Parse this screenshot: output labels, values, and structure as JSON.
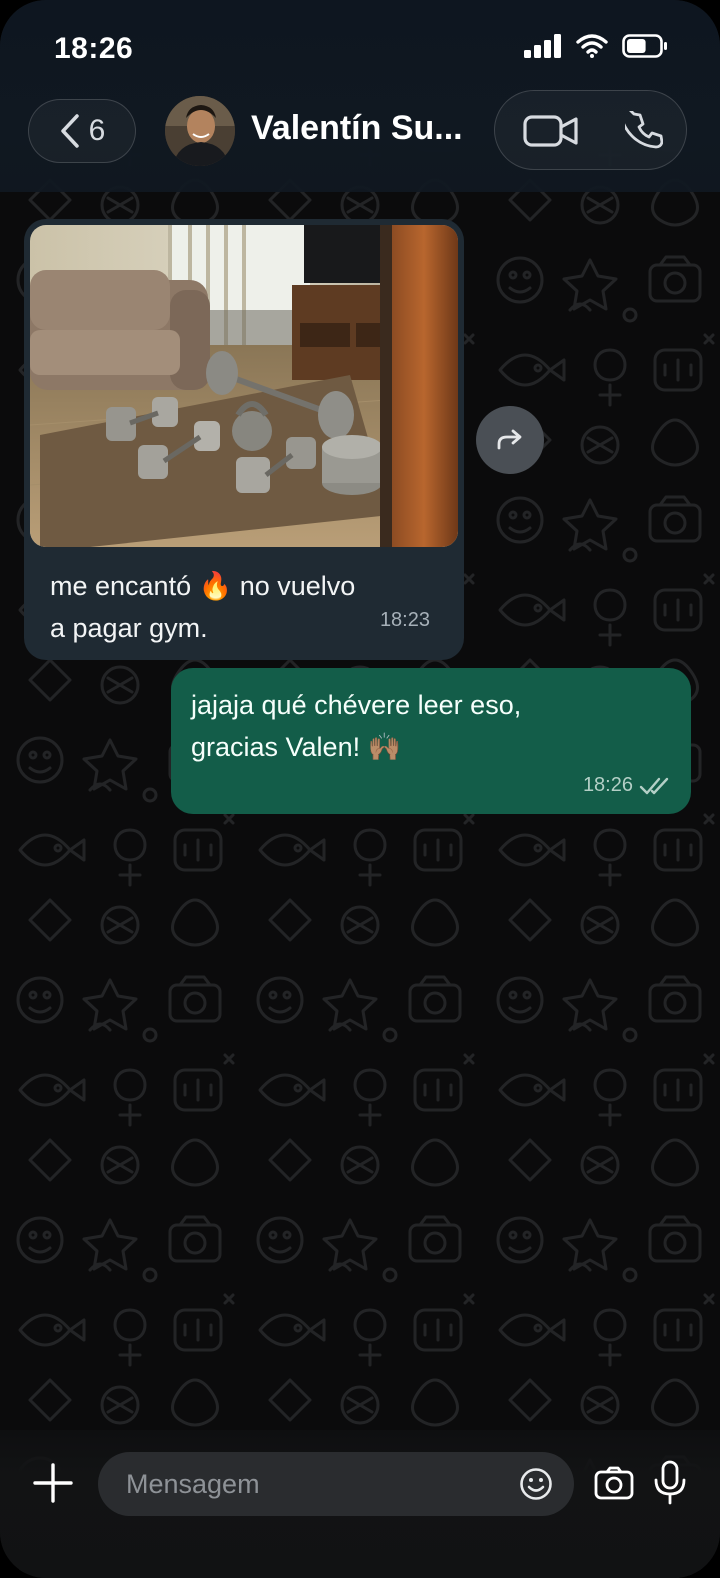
{
  "status_bar": {
    "time": "18:26",
    "battery_level": 0.6
  },
  "header": {
    "back_count": "6",
    "contact_name": "Valentín Su...",
    "icons": [
      "chevron-left-icon",
      "video-call-icon",
      "phone-call-icon"
    ]
  },
  "messages": [
    {
      "direction": "incoming",
      "type": "image",
      "caption": "me encantó 🔥  no vuelvo a pagar gym.",
      "time": "18:23"
    },
    {
      "direction": "outgoing",
      "type": "text",
      "text": "jajaja qué chévere leer eso, gracias Valen! 🙌🏽",
      "time": "18:26",
      "status": "read"
    }
  ],
  "composer": {
    "placeholder": "Mensagem",
    "icons": [
      "plus-icon",
      "sticker-icon",
      "camera-icon",
      "microphone-icon"
    ]
  },
  "colors": {
    "header_bg": "#101821",
    "incoming_bubble": "#1f2a33",
    "outgoing_bubble": "#135d49",
    "wallpaper": "#0b0b0c",
    "input_bg": "#2a2c2f"
  }
}
